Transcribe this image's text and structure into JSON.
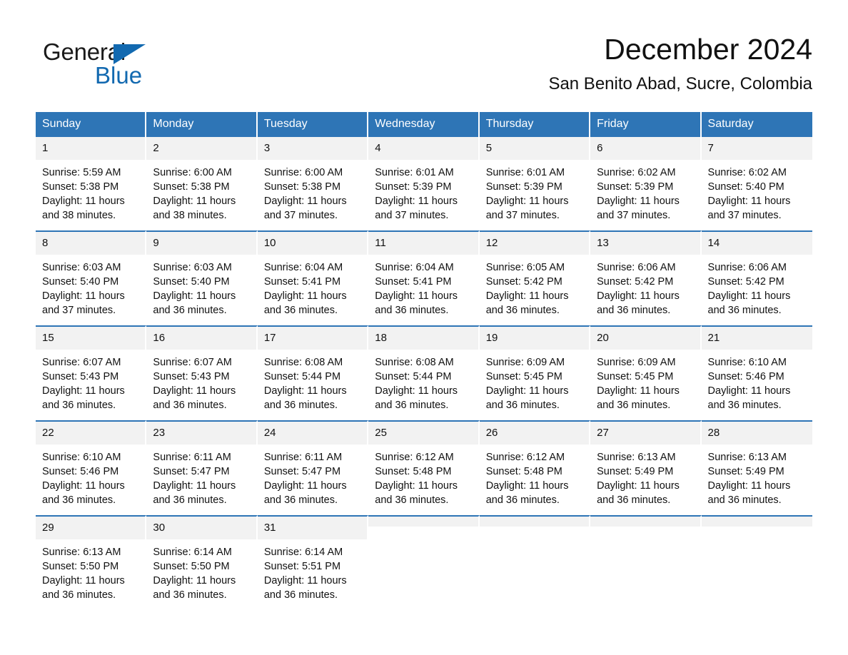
{
  "brand": {
    "name_dark": "General",
    "name_blue": "Blue",
    "logo_icon": "blue-triangle-logo",
    "dark_color": "#1a1a1a",
    "blue_color": "#1269b0"
  },
  "header": {
    "title": "December 2024",
    "subtitle": "San Benito Abad, Sucre, Colombia"
  },
  "theme": {
    "header_blue": "#2e75b6",
    "daynum_background": "#f2f2f2",
    "page_background": "#ffffff",
    "text_color": "#111111"
  },
  "weekdays": [
    "Sunday",
    "Monday",
    "Tuesday",
    "Wednesday",
    "Thursday",
    "Friday",
    "Saturday"
  ],
  "weeks": [
    [
      {
        "day": "1",
        "sunrise": "Sunrise: 5:59 AM",
        "sunset": "Sunset: 5:38 PM",
        "daylight_line1": "Daylight: 11 hours",
        "daylight_line2": "and 38 minutes."
      },
      {
        "day": "2",
        "sunrise": "Sunrise: 6:00 AM",
        "sunset": "Sunset: 5:38 PM",
        "daylight_line1": "Daylight: 11 hours",
        "daylight_line2": "and 38 minutes."
      },
      {
        "day": "3",
        "sunrise": "Sunrise: 6:00 AM",
        "sunset": "Sunset: 5:38 PM",
        "daylight_line1": "Daylight: 11 hours",
        "daylight_line2": "and 37 minutes."
      },
      {
        "day": "4",
        "sunrise": "Sunrise: 6:01 AM",
        "sunset": "Sunset: 5:39 PM",
        "daylight_line1": "Daylight: 11 hours",
        "daylight_line2": "and 37 minutes."
      },
      {
        "day": "5",
        "sunrise": "Sunrise: 6:01 AM",
        "sunset": "Sunset: 5:39 PM",
        "daylight_line1": "Daylight: 11 hours",
        "daylight_line2": "and 37 minutes."
      },
      {
        "day": "6",
        "sunrise": "Sunrise: 6:02 AM",
        "sunset": "Sunset: 5:39 PM",
        "daylight_line1": "Daylight: 11 hours",
        "daylight_line2": "and 37 minutes."
      },
      {
        "day": "7",
        "sunrise": "Sunrise: 6:02 AM",
        "sunset": "Sunset: 5:40 PM",
        "daylight_line1": "Daylight: 11 hours",
        "daylight_line2": "and 37 minutes."
      }
    ],
    [
      {
        "day": "8",
        "sunrise": "Sunrise: 6:03 AM",
        "sunset": "Sunset: 5:40 PM",
        "daylight_line1": "Daylight: 11 hours",
        "daylight_line2": "and 37 minutes."
      },
      {
        "day": "9",
        "sunrise": "Sunrise: 6:03 AM",
        "sunset": "Sunset: 5:40 PM",
        "daylight_line1": "Daylight: 11 hours",
        "daylight_line2": "and 36 minutes."
      },
      {
        "day": "10",
        "sunrise": "Sunrise: 6:04 AM",
        "sunset": "Sunset: 5:41 PM",
        "daylight_line1": "Daylight: 11 hours",
        "daylight_line2": "and 36 minutes."
      },
      {
        "day": "11",
        "sunrise": "Sunrise: 6:04 AM",
        "sunset": "Sunset: 5:41 PM",
        "daylight_line1": "Daylight: 11 hours",
        "daylight_line2": "and 36 minutes."
      },
      {
        "day": "12",
        "sunrise": "Sunrise: 6:05 AM",
        "sunset": "Sunset: 5:42 PM",
        "daylight_line1": "Daylight: 11 hours",
        "daylight_line2": "and 36 minutes."
      },
      {
        "day": "13",
        "sunrise": "Sunrise: 6:06 AM",
        "sunset": "Sunset: 5:42 PM",
        "daylight_line1": "Daylight: 11 hours",
        "daylight_line2": "and 36 minutes."
      },
      {
        "day": "14",
        "sunrise": "Sunrise: 6:06 AM",
        "sunset": "Sunset: 5:42 PM",
        "daylight_line1": "Daylight: 11 hours",
        "daylight_line2": "and 36 minutes."
      }
    ],
    [
      {
        "day": "15",
        "sunrise": "Sunrise: 6:07 AM",
        "sunset": "Sunset: 5:43 PM",
        "daylight_line1": "Daylight: 11 hours",
        "daylight_line2": "and 36 minutes."
      },
      {
        "day": "16",
        "sunrise": "Sunrise: 6:07 AM",
        "sunset": "Sunset: 5:43 PM",
        "daylight_line1": "Daylight: 11 hours",
        "daylight_line2": "and 36 minutes."
      },
      {
        "day": "17",
        "sunrise": "Sunrise: 6:08 AM",
        "sunset": "Sunset: 5:44 PM",
        "daylight_line1": "Daylight: 11 hours",
        "daylight_line2": "and 36 minutes."
      },
      {
        "day": "18",
        "sunrise": "Sunrise: 6:08 AM",
        "sunset": "Sunset: 5:44 PM",
        "daylight_line1": "Daylight: 11 hours",
        "daylight_line2": "and 36 minutes."
      },
      {
        "day": "19",
        "sunrise": "Sunrise: 6:09 AM",
        "sunset": "Sunset: 5:45 PM",
        "daylight_line1": "Daylight: 11 hours",
        "daylight_line2": "and 36 minutes."
      },
      {
        "day": "20",
        "sunrise": "Sunrise: 6:09 AM",
        "sunset": "Sunset: 5:45 PM",
        "daylight_line1": "Daylight: 11 hours",
        "daylight_line2": "and 36 minutes."
      },
      {
        "day": "21",
        "sunrise": "Sunrise: 6:10 AM",
        "sunset": "Sunset: 5:46 PM",
        "daylight_line1": "Daylight: 11 hours",
        "daylight_line2": "and 36 minutes."
      }
    ],
    [
      {
        "day": "22",
        "sunrise": "Sunrise: 6:10 AM",
        "sunset": "Sunset: 5:46 PM",
        "daylight_line1": "Daylight: 11 hours",
        "daylight_line2": "and 36 minutes."
      },
      {
        "day": "23",
        "sunrise": "Sunrise: 6:11 AM",
        "sunset": "Sunset: 5:47 PM",
        "daylight_line1": "Daylight: 11 hours",
        "daylight_line2": "and 36 minutes."
      },
      {
        "day": "24",
        "sunrise": "Sunrise: 6:11 AM",
        "sunset": "Sunset: 5:47 PM",
        "daylight_line1": "Daylight: 11 hours",
        "daylight_line2": "and 36 minutes."
      },
      {
        "day": "25",
        "sunrise": "Sunrise: 6:12 AM",
        "sunset": "Sunset: 5:48 PM",
        "daylight_line1": "Daylight: 11 hours",
        "daylight_line2": "and 36 minutes."
      },
      {
        "day": "26",
        "sunrise": "Sunrise: 6:12 AM",
        "sunset": "Sunset: 5:48 PM",
        "daylight_line1": "Daylight: 11 hours",
        "daylight_line2": "and 36 minutes."
      },
      {
        "day": "27",
        "sunrise": "Sunrise: 6:13 AM",
        "sunset": "Sunset: 5:49 PM",
        "daylight_line1": "Daylight: 11 hours",
        "daylight_line2": "and 36 minutes."
      },
      {
        "day": "28",
        "sunrise": "Sunrise: 6:13 AM",
        "sunset": "Sunset: 5:49 PM",
        "daylight_line1": "Daylight: 11 hours",
        "daylight_line2": "and 36 minutes."
      }
    ],
    [
      {
        "day": "29",
        "sunrise": "Sunrise: 6:13 AM",
        "sunset": "Sunset: 5:50 PM",
        "daylight_line1": "Daylight: 11 hours",
        "daylight_line2": "and 36 minutes."
      },
      {
        "day": "30",
        "sunrise": "Sunrise: 6:14 AM",
        "sunset": "Sunset: 5:50 PM",
        "daylight_line1": "Daylight: 11 hours",
        "daylight_line2": "and 36 minutes."
      },
      {
        "day": "31",
        "sunrise": "Sunrise: 6:14 AM",
        "sunset": "Sunset: 5:51 PM",
        "daylight_line1": "Daylight: 11 hours",
        "daylight_line2": "and 36 minutes."
      },
      {
        "day": "",
        "sunrise": "",
        "sunset": "",
        "daylight_line1": "",
        "daylight_line2": ""
      },
      {
        "day": "",
        "sunrise": "",
        "sunset": "",
        "daylight_line1": "",
        "daylight_line2": ""
      },
      {
        "day": "",
        "sunrise": "",
        "sunset": "",
        "daylight_line1": "",
        "daylight_line2": ""
      },
      {
        "day": "",
        "sunrise": "",
        "sunset": "",
        "daylight_line1": "",
        "daylight_line2": ""
      }
    ]
  ]
}
